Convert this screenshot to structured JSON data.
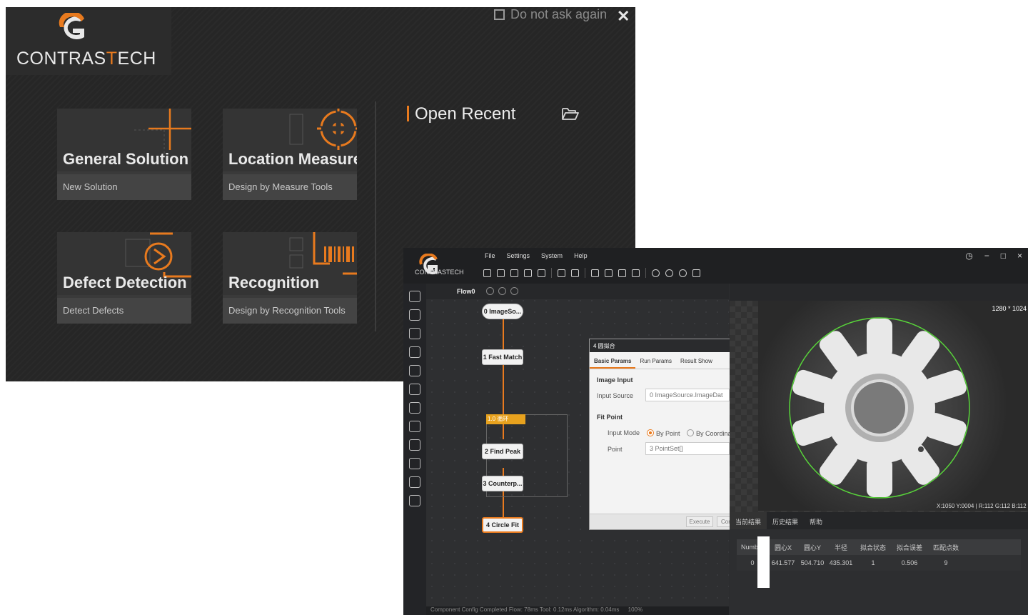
{
  "start_dialog": {
    "logo": {
      "prefix": "CONTRAS",
      "t": "T",
      "suffix": "ECH"
    },
    "do_not_ask": "Do not ask again",
    "close": "✕",
    "cards": [
      {
        "title": "General Solution",
        "subtitle": "New Solution"
      },
      {
        "title": "Location Measure",
        "subtitle": "Design by Measure Tools"
      },
      {
        "title": "Defect Detection",
        "subtitle": "Detect Defects"
      },
      {
        "title": "Recognition",
        "subtitle": "Design by Recognition Tools"
      }
    ],
    "open_recent": "Open Recent",
    "accent_color": "#e87a1e"
  },
  "app": {
    "logo_text": "CONTRASTECH",
    "menu": [
      "File",
      "Settings",
      "System",
      "Help"
    ],
    "window_controls": [
      "◷",
      "−",
      "□",
      "×"
    ],
    "flow_tab": "Flow0",
    "nodes": {
      "n0": "0 ImageSo...",
      "n1": "1 Fast Match",
      "loop": "1.0 循环",
      "n2": "2 Find Peak",
      "n3": "3 Counterp...",
      "n4": "4 Circle Fit"
    },
    "dialog": {
      "title": "4 圆拟合",
      "tabs": [
        "Basic Params",
        "Run Params",
        "Result Show"
      ],
      "section_image_input": "Image Input",
      "input_source_label": "Input Source",
      "input_source_value": "0 ImageSource.ImageDat",
      "section_fit_point": "Fit Point",
      "input_mode_label": "Input Mode",
      "mode_by_point": "By Point",
      "mode_by_coordinate": "By Coordinate",
      "point_label": "Point",
      "point_value": "3 PointSet[]",
      "execute": "Execute",
      "confirm": "Confirm"
    },
    "status": "Component Config Completed   Flow: 78ms   Tool: 0.12ms   Algorithm: 0.04ms",
    "zoom": "100%",
    "image": {
      "resolution": "1280 * 1024",
      "pixel_info": "X:1050  Y:0004  |  R:112  G:112  B:112"
    },
    "results": {
      "tabs": [
        "当前结果",
        "历史结果",
        "帮助"
      ],
      "columns": [
        "Number",
        "圆心X",
        "圆心Y",
        "半径",
        "拟合状态",
        "拟合误差",
        "匹配点数"
      ],
      "rows": [
        [
          "0",
          "641.577",
          "504.710",
          "435.301",
          "1",
          "0.506",
          "9"
        ]
      ]
    }
  }
}
